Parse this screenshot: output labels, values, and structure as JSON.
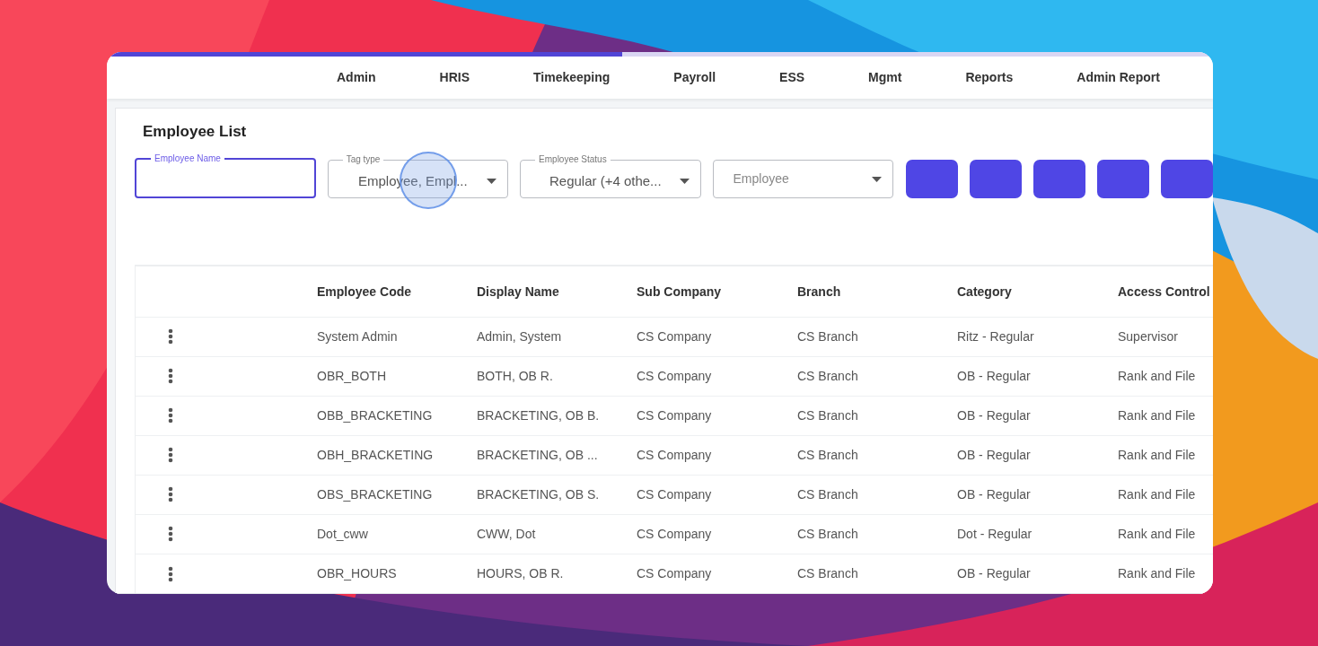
{
  "progress": {
    "level": 0.466
  },
  "nav": [
    {
      "label": "Admin"
    },
    {
      "label": "HRIS"
    },
    {
      "label": "Timekeeping"
    },
    {
      "label": "Payroll"
    },
    {
      "label": "ESS"
    },
    {
      "label": "Mgmt"
    },
    {
      "label": "Reports"
    },
    {
      "label": "Admin Report"
    }
  ],
  "title": "Employee List",
  "filters": [
    {
      "kind": "text",
      "label": "Employee Name",
      "focused": true
    },
    {
      "kind": "select",
      "label": "Tag type",
      "value": "Employee, Empl...",
      "focused": false
    },
    {
      "kind": "select",
      "label": "Employee Status",
      "value": "Regular (+4 othe...",
      "focused": false
    },
    {
      "kind": "select",
      "placeholder": "Employee",
      "focused": false
    }
  ],
  "toolbar_buttons": [
    {
      "kind": "filled"
    },
    {
      "kind": "filled"
    },
    {
      "kind": "filled"
    },
    {
      "kind": "filled"
    },
    {
      "kind": "filled"
    }
  ],
  "table": {
    "columns": [
      "Employee Code",
      "Display Name",
      "Sub Company",
      "Branch",
      "Category",
      "Access Control"
    ],
    "rows": [
      [
        "System Admin",
        "Admin, System",
        "CS Company",
        "CS Branch",
        "Ritz - Regular",
        "Supervisor"
      ],
      [
        "OBR_BOTH",
        "BOTH, OB R.",
        "CS Company",
        "CS Branch",
        "OB - Regular",
        "Rank and File"
      ],
      [
        "OBB_BRACKETING",
        "BRACKETING, OB B.",
        "CS Company",
        "CS Branch",
        "OB - Regular",
        "Rank and File"
      ],
      [
        "OBH_BRACKETING",
        "BRACKETING, OB ...",
        "CS Company",
        "CS Branch",
        "OB - Regular",
        "Rank and File"
      ],
      [
        "OBS_BRACKETING",
        "BRACKETING, OB S.",
        "CS Company",
        "CS Branch",
        "OB - Regular",
        "Rank and File"
      ],
      [
        "Dot_cww",
        "CWW, Dot",
        "CS Company",
        "CS Branch",
        "Dot - Regular",
        "Rank and File"
      ],
      [
        "OBR_HOURS",
        "HOURS, OB R.",
        "CS Company",
        "CS Branch",
        "OB - Regular",
        "Rank and File"
      ]
    ]
  }
}
